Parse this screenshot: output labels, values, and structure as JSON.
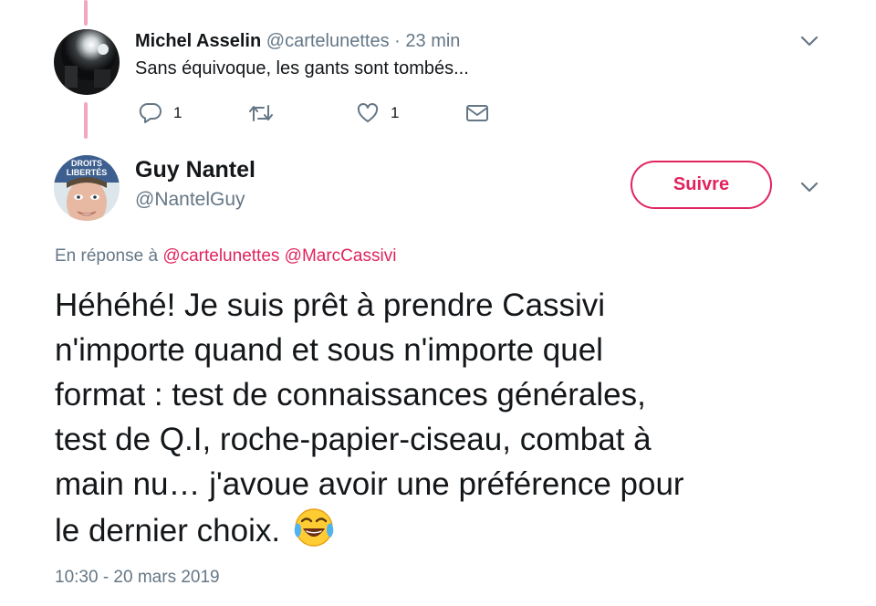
{
  "reply_tweet": {
    "name": "Michel Asselin",
    "handle": "@cartelunettes",
    "separator": "·",
    "time": "23 min",
    "text": "Sans équivoque, les gants sont tombés...",
    "actions": {
      "reply_count": "1",
      "like_count": "1"
    }
  },
  "main_tweet": {
    "name": "Guy Nantel",
    "handle": "@NantelGuy",
    "follow_label": "Suivre",
    "avatar_caption_1": "DROITS",
    "avatar_caption_2": "LIBERTÉS",
    "in_reply_to_prefix": "En réponse à",
    "mentions": [
      "@cartelunettes",
      "@MarcCassivi"
    ],
    "text_lines": [
      "Héhéhé! Je suis prêt à prendre Cassivi",
      "n'importe quand et sous n'importe quel",
      "format : test de connaissances générales,",
      "test de Q.I, roche-papier-ciseau, combat à",
      "main nu… j'avoue avoir une préférence pour",
      "le dernier choix."
    ],
    "emoji_icon": "face-with-tears-of-joy-icon",
    "timestamp": "10:30 - 20 mars 2019"
  },
  "colors": {
    "accent": "#e0245e",
    "thread_line": "#f2a7be",
    "muted_text": "#657786",
    "primary_text": "#14171a"
  }
}
